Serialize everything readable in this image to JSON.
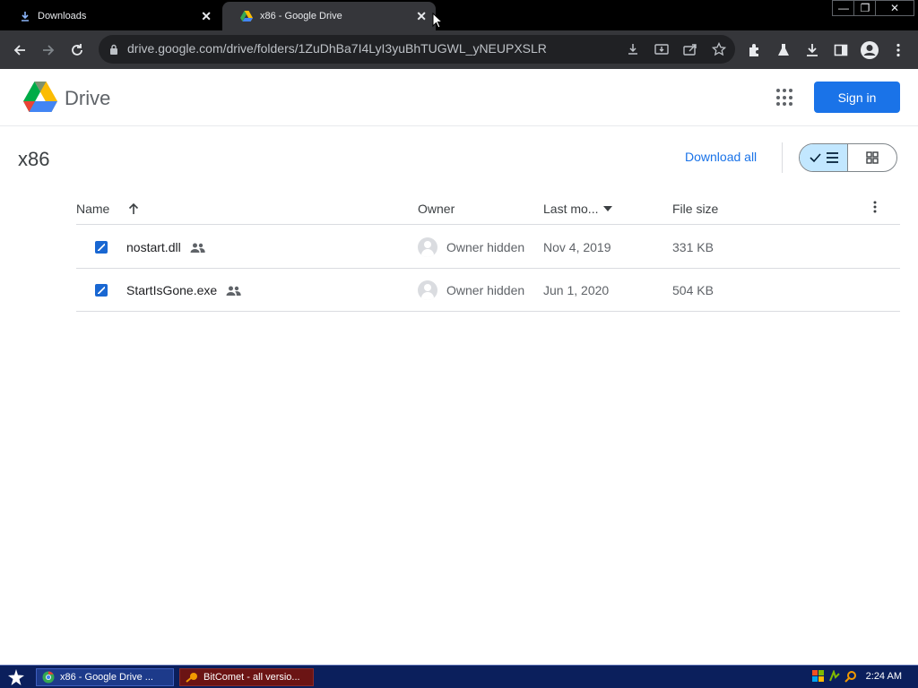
{
  "browser": {
    "tabs": [
      {
        "label": "Downloads",
        "icon": "download-icon",
        "active": false
      },
      {
        "label": "x86 - Google Drive",
        "icon": "google-drive-icon",
        "active": true
      }
    ],
    "tab_close_glyph": "✕",
    "window_controls": {
      "minimize": "—",
      "restore": "❐",
      "close": "✕"
    },
    "url": "drive.google.com/drive/folders/1ZuDhBa7I4LyI3yuBhTUGWL_yNEUPXSLR"
  },
  "drive": {
    "logo_text": "Drive",
    "sign_in": "Sign in",
    "folder_title": "x86",
    "download_all": "Download all",
    "columns": {
      "name": "Name",
      "owner": "Owner",
      "last_modified": "Last mo...",
      "file_size": "File size"
    },
    "files": [
      {
        "name": "nostart.dll",
        "owner": "Owner hidden",
        "modified": "Nov 4, 2019",
        "size": "331 KB"
      },
      {
        "name": "StartIsGone.exe",
        "owner": "Owner hidden",
        "modified": "Jun 1, 2020",
        "size": "504 KB"
      }
    ],
    "colors": {
      "accent": "#1a73e8",
      "selected_view": "#c2e7ff"
    }
  },
  "taskbar": {
    "items": [
      {
        "label": "x86 - Google Drive ...",
        "icon": "chrome-icon"
      },
      {
        "label": "BitComet - all versio...",
        "icon": "bitcomet-icon"
      }
    ],
    "clock": "2:24 AM"
  }
}
